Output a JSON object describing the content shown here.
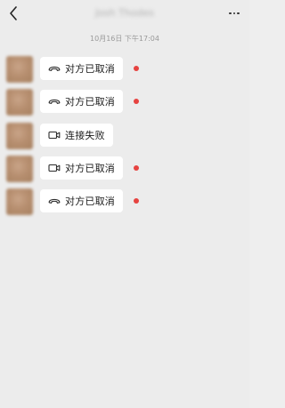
{
  "header": {
    "back_icon": "chevron-left-icon",
    "title": "Josh Thodes",
    "more_icon": "more-dots-icon"
  },
  "timestamp": "10月16日 下午17:04",
  "messages": [
    {
      "icon": "phone-hangup-icon",
      "text": "对方已取消",
      "unread": true
    },
    {
      "icon": "phone-hangup-icon",
      "text": "对方已取消",
      "unread": true
    },
    {
      "icon": "video-camera-icon",
      "text": "连接失败",
      "unread": false
    },
    {
      "icon": "video-camera-icon",
      "text": "对方已取消",
      "unread": true
    },
    {
      "icon": "phone-hangup-icon",
      "text": "对方已取消",
      "unread": true
    }
  ],
  "colors": {
    "background": "#ececec",
    "bubble": "#ffffff",
    "unread_dot": "#e64340"
  }
}
